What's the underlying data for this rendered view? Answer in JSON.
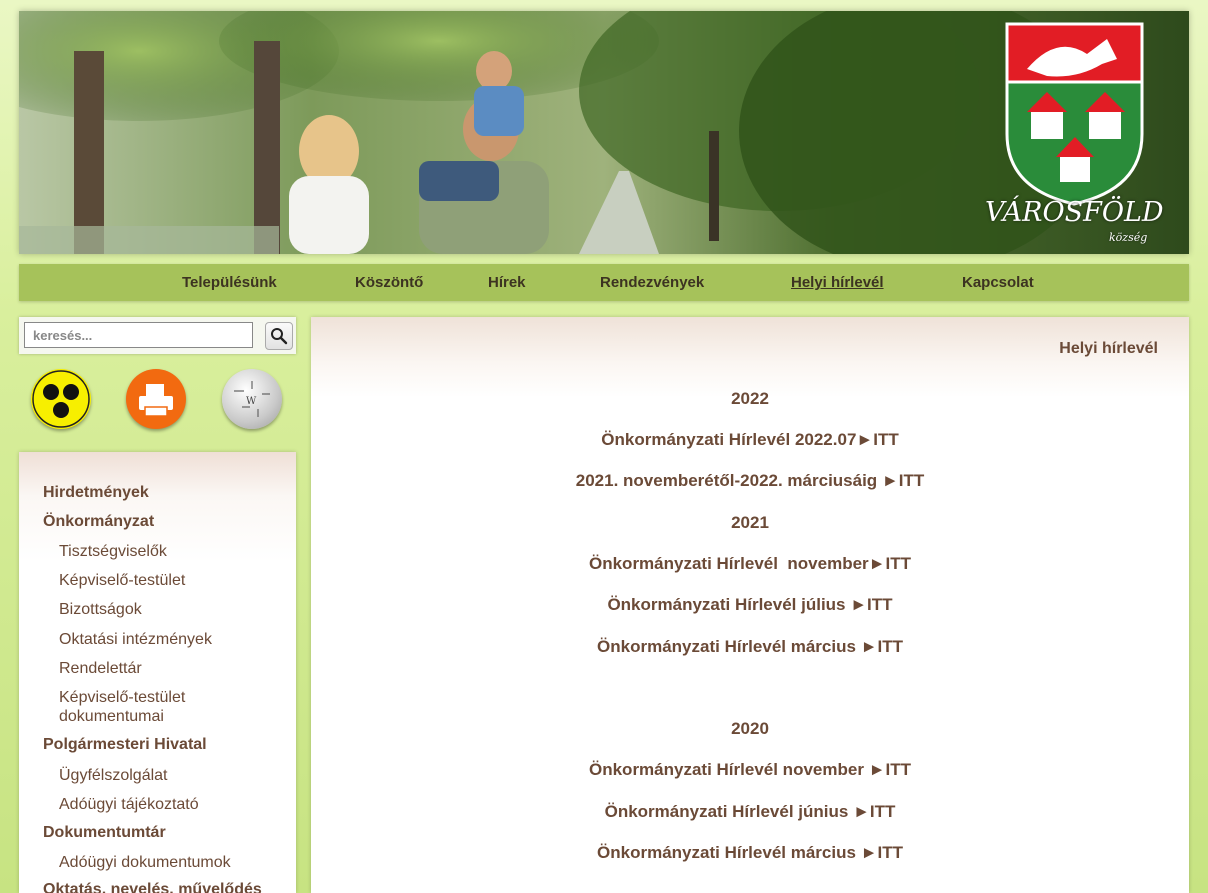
{
  "header": {
    "brand_title": "VÁROSFÖLD",
    "brand_subtitle": "község"
  },
  "topnav": {
    "items": [
      {
        "label": "Településünk"
      },
      {
        "label": "Köszöntő"
      },
      {
        "label": "Hírek"
      },
      {
        "label": "Rendezvények"
      },
      {
        "label": "Helyi hírlevél",
        "active": true
      },
      {
        "label": "Kapcsolat"
      }
    ]
  },
  "search": {
    "placeholder": "keresés..."
  },
  "quick_icons": [
    {
      "icon": "accessibility-blind-icon",
      "color": "#f7ef00"
    },
    {
      "icon": "printer-icon",
      "color": "#f26a10"
    },
    {
      "icon": "wikipedia-globe-icon",
      "color": "#dcdcdc"
    }
  ],
  "sidemenu": {
    "items": [
      {
        "label": "Hirdetmények"
      },
      {
        "label": "Önkormányzat"
      },
      {
        "label": "Tisztségviselők"
      },
      {
        "label": "Képviselő-testület"
      },
      {
        "label": "Bizottságok"
      },
      {
        "label": "Oktatási intézmények"
      },
      {
        "label": "Rendelettár"
      },
      {
        "label": "Képviselő-testület dokumentumai"
      },
      {
        "label": "Polgármesteri Hivatal"
      },
      {
        "label": "Ügyfélszolgálat"
      },
      {
        "label": "Adóügyi tájékoztató"
      },
      {
        "label": "Dokumentumtár"
      },
      {
        "label": "Adóügyi dokumentumok"
      },
      {
        "label": "Oktatás, nevelés, művelődés"
      }
    ]
  },
  "content": {
    "title": "Helyi hírlevél",
    "lines": [
      "2022",
      "Önkormányzati Hírlevél 2022.07►ITT",
      "2021. novemberétől-2022. márciusáig ►ITT",
      "2021",
      "Önkormányzati Hírlevél  november►ITT",
      "Önkormányzati Hírlevél július ►ITT",
      "Önkormányzati Hírlevél március ►ITT",
      "2020",
      "Önkormányzati Hírlevél november ►ITT",
      "Önkormányzati Hírlevél június ►ITT",
      "Önkormányzati Hírlevél március ►ITT"
    ]
  }
}
